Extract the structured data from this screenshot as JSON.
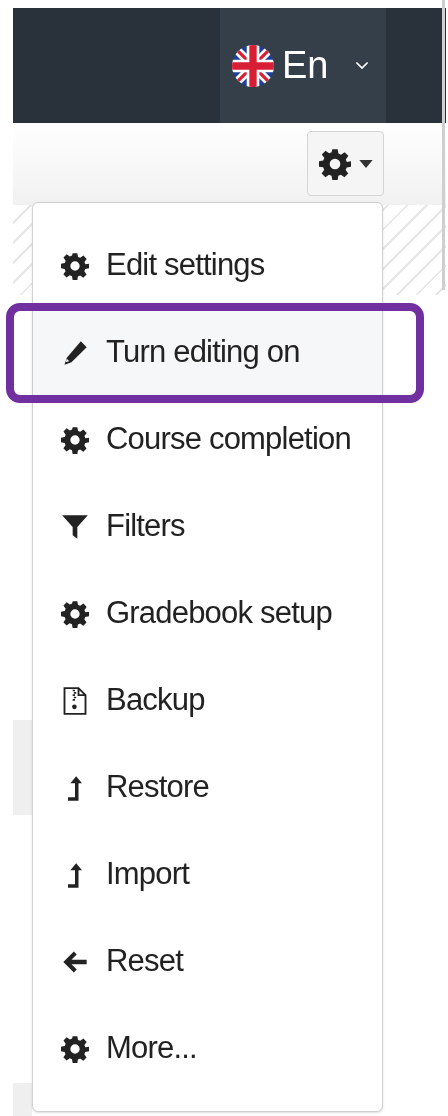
{
  "navbar": {
    "language": {
      "label": "En"
    }
  },
  "menu": {
    "items": [
      {
        "label": "Edit settings",
        "kind": "gear",
        "highlighted": false
      },
      {
        "label": "Turn editing on",
        "kind": "pencil",
        "highlighted": true
      },
      {
        "label": "Course completion",
        "kind": "gear",
        "highlighted": false
      },
      {
        "label": "Filters",
        "kind": "filter",
        "highlighted": false
      },
      {
        "label": "Gradebook setup",
        "kind": "gear",
        "highlighted": false
      },
      {
        "label": "Backup",
        "kind": "archive",
        "highlighted": false
      },
      {
        "label": "Restore",
        "kind": "level-up",
        "highlighted": false
      },
      {
        "label": "Import",
        "kind": "level-up",
        "highlighted": false
      },
      {
        "label": "Reset",
        "kind": "arrow-left",
        "highlighted": false
      },
      {
        "label": "More...",
        "kind": "gear",
        "highlighted": false
      }
    ]
  }
}
